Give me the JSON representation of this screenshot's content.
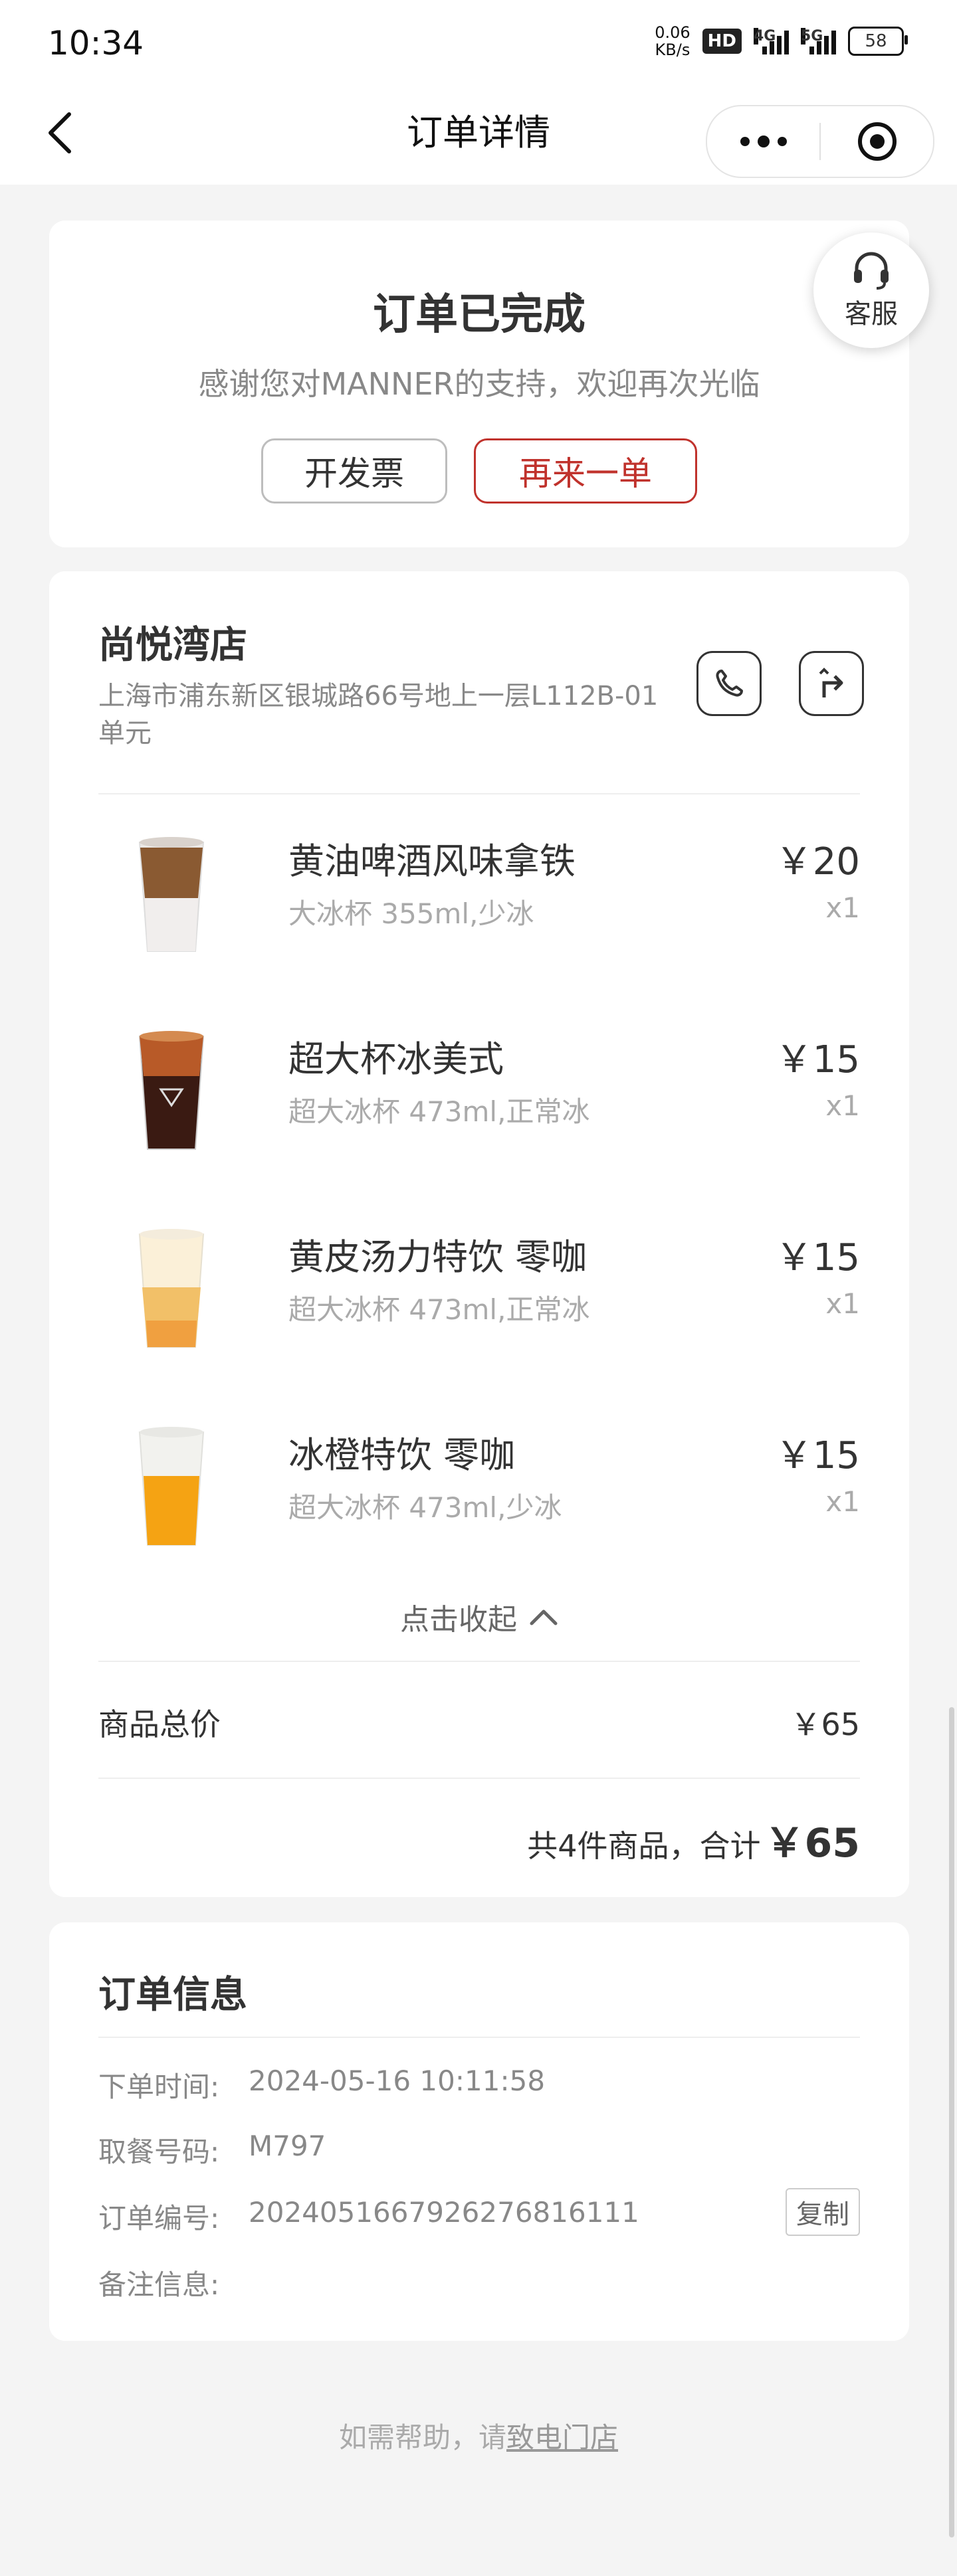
{
  "status_bar": {
    "time": "10:34",
    "net_speed_value": "0.06",
    "net_speed_unit": "KB/s",
    "hd_badge": "HD",
    "sim1_label": "4G",
    "sim2_label": "5G",
    "battery": "58"
  },
  "navbar": {
    "title": "订单详情"
  },
  "order_status": {
    "title": "订单已完成",
    "subtitle": "感谢您对MANNER的支持，欢迎再次光临",
    "invoice_button": "开发票",
    "reorder_button": "再来一单",
    "service_label": "客服"
  },
  "store": {
    "name": "尚悦湾店",
    "address": "上海市浦东新区银城路66号地上一层L112B-01单元"
  },
  "items": [
    {
      "name": "黄油啤酒风味拿铁",
      "spec": "大冰杯 355ml,少冰",
      "price": "￥20",
      "qty": "x1",
      "drink_color": "#8a5a32"
    },
    {
      "name": "超大杯冰美式",
      "spec": "超大冰杯 473ml,正常冰",
      "price": "￥15",
      "qty": "x1",
      "drink_color": "#3a1a12"
    },
    {
      "name": "黄皮汤力特饮 零咖",
      "spec": "超大冰杯 473ml,正常冰",
      "price": "￥15",
      "qty": "x1",
      "drink_color": "#f2c068"
    },
    {
      "name": "冰橙特饮 零咖",
      "spec": "超大冰杯 473ml,少冰",
      "price": "￥15",
      "qty": "x1",
      "drink_color": "#f5a313"
    }
  ],
  "collapse_label": "点击收起",
  "summary": {
    "subtotal_label": "商品总价",
    "subtotal_value": "￥65",
    "total_text": "共4件商品，合计",
    "total_amount": "￥65"
  },
  "order_info": {
    "title": "订单信息",
    "rows": [
      {
        "label": "下单时间:",
        "value": "2024-05-16 10:11:58"
      },
      {
        "label": "取餐号码:",
        "value": "M797"
      },
      {
        "label": "订单编号:",
        "value": "2024051667926276816111"
      },
      {
        "label": "备注信息:",
        "value": ""
      }
    ],
    "copy_button": "复制"
  },
  "help": {
    "prefix": "如需帮助，请",
    "link": "致电门店"
  }
}
